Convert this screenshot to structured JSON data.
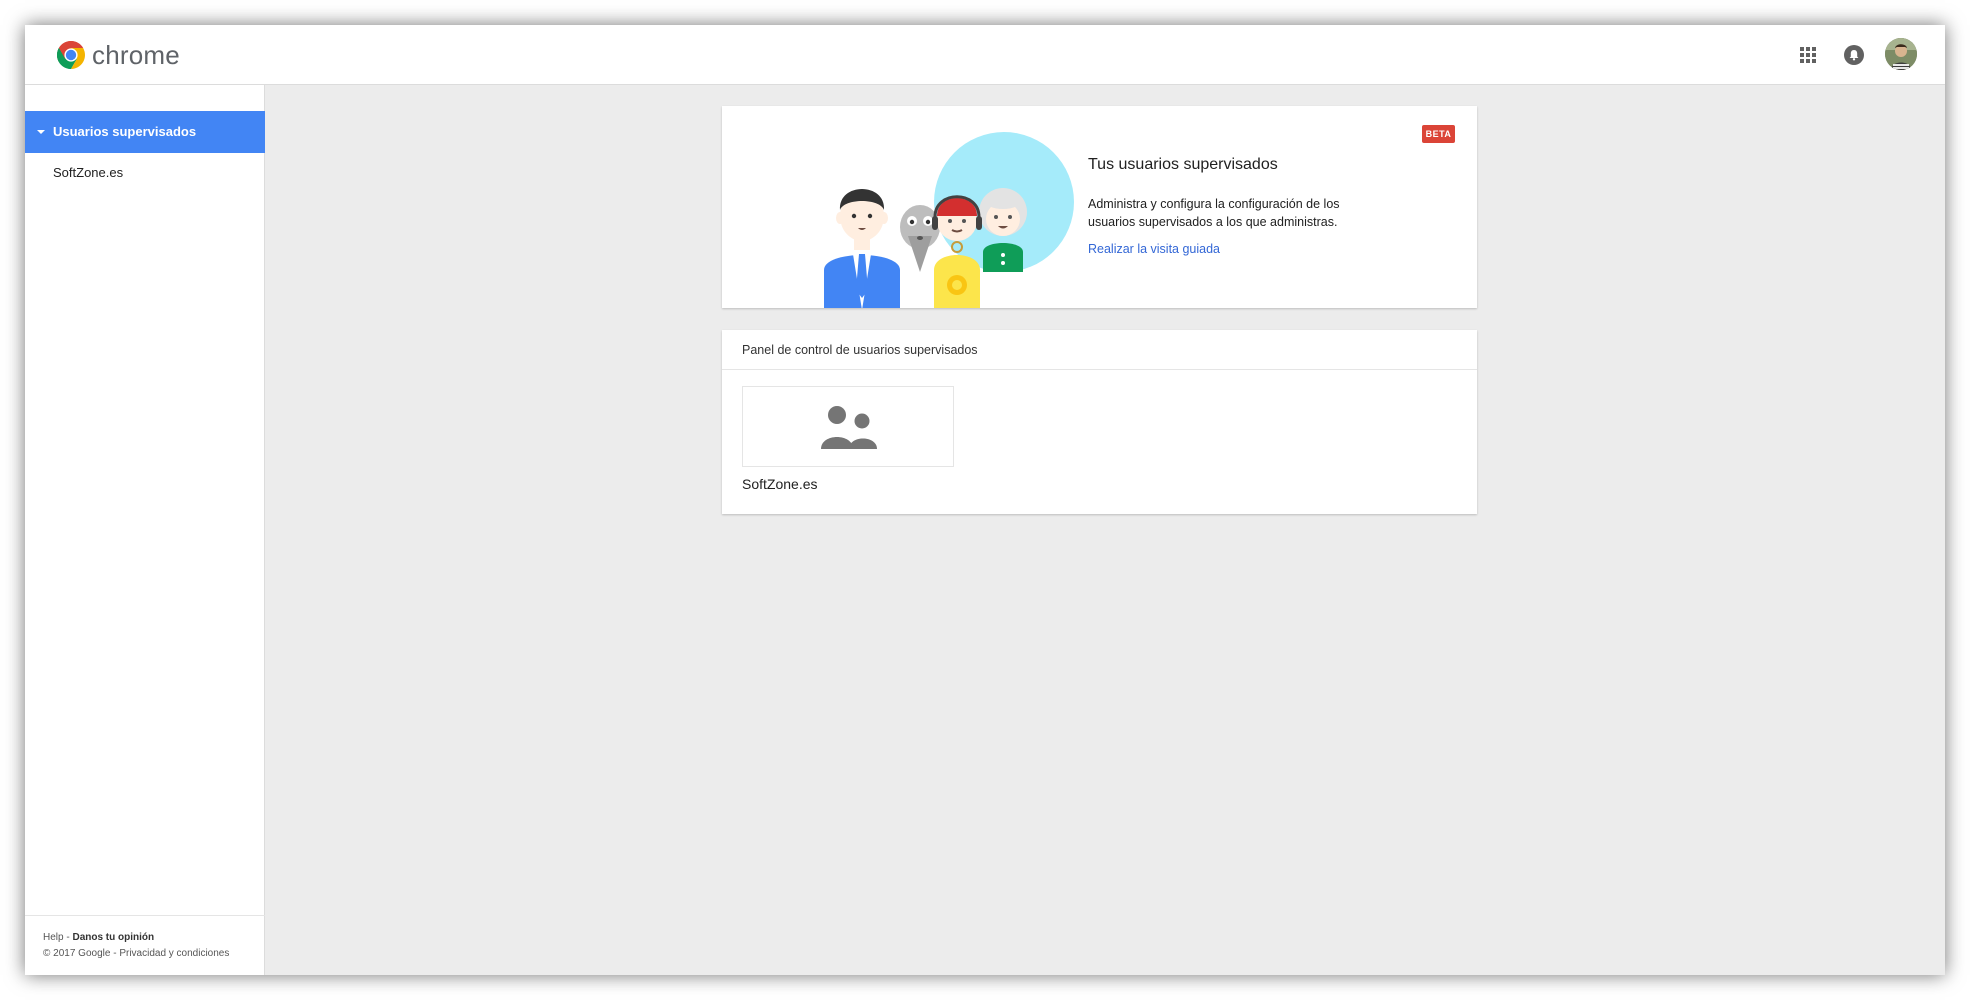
{
  "app": {
    "logo_text": "chrome"
  },
  "header": {
    "apps_icon": "apps-grid-icon",
    "notifications_icon": "notifications-bell-icon",
    "avatar_icon": "account-avatar"
  },
  "sidebar": {
    "section_title": "Usuarios supervisados",
    "items": [
      {
        "label": "SoftZone.es"
      }
    ],
    "footer": {
      "help": "Help",
      "separator1": " - ",
      "feedback": "Danos tu opinión",
      "copyright": "© 2017 Google",
      "separator2": " - ",
      "privacy_terms": "Privacidad y condiciones"
    }
  },
  "hero": {
    "title": "Tus usuarios supervisados",
    "description": "Administra y configura la configuración de los usuarios supervisados a los que administras.",
    "link": "Realizar la visita guiada",
    "badge": "BETA"
  },
  "panel": {
    "title": "Panel de control de usuarios supervisados",
    "users": [
      {
        "name": "SoftZone.es",
        "icon": "supervised-users-icon"
      }
    ]
  },
  "colors": {
    "accent": "#4285f4",
    "badge": "#db4437",
    "link": "#3367d6",
    "background": "#ececec"
  }
}
